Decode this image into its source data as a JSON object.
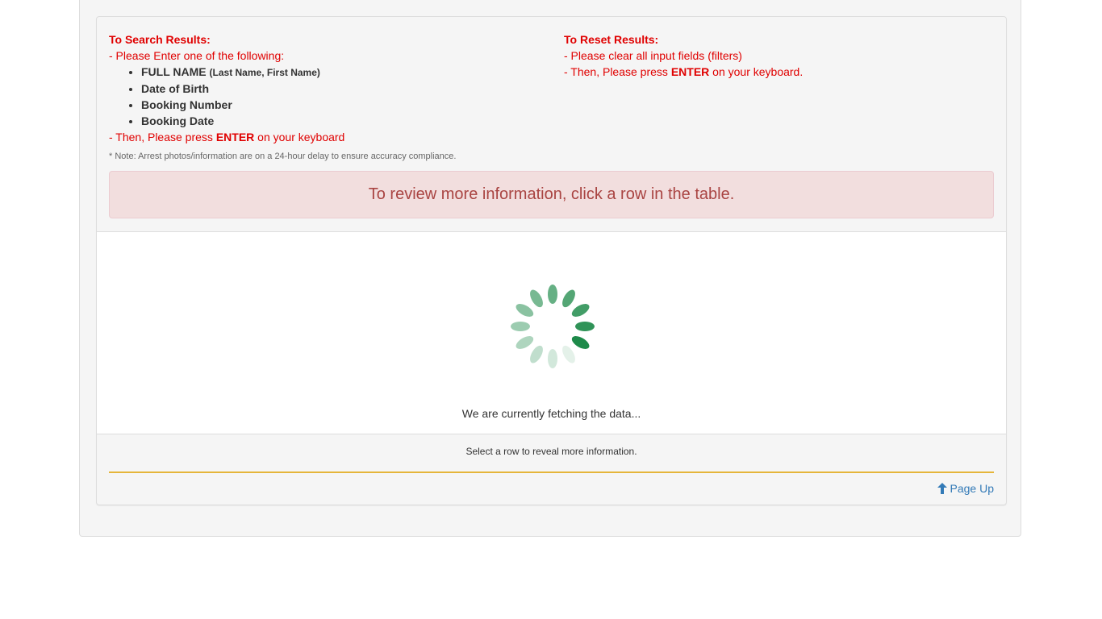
{
  "search": {
    "title": "To Search Results:",
    "intro": "- Please Enter one of the following:",
    "items": [
      {
        "label": "FULL NAME",
        "sub": "(Last Name, First Name)"
      },
      {
        "label": "Date of Birth",
        "sub": ""
      },
      {
        "label": "Booking Number",
        "sub": ""
      },
      {
        "label": "Booking Date",
        "sub": ""
      }
    ],
    "then_prefix": "- Then, Please press ",
    "then_key": "ENTER",
    "then_suffix": " on your keyboard"
  },
  "reset": {
    "title": "To Reset Results:",
    "line1": "- Please clear all input fields (filters)",
    "then_prefix": "- Then, Please press ",
    "then_key": "ENTER",
    "then_suffix": " on your keyboard."
  },
  "note": "* Note: Arrest photos/information are on a 24-hour delay to ensure accuracy compliance.",
  "alert": "To review more information, click a row in the table.",
  "loading": {
    "text": "We are currently fetching the data...",
    "color": "#1e8a4a"
  },
  "footer": {
    "hint": "Select a row to reveal more information.",
    "page_up": "Page Up",
    "page_up_icon": "arrow-up-icon"
  },
  "colors": {
    "instruction_red": "#e00000",
    "alert_text": "#a94442",
    "alert_bg": "#f2dede",
    "divider_gold": "#e5b53a",
    "link_blue": "#337ab7"
  }
}
